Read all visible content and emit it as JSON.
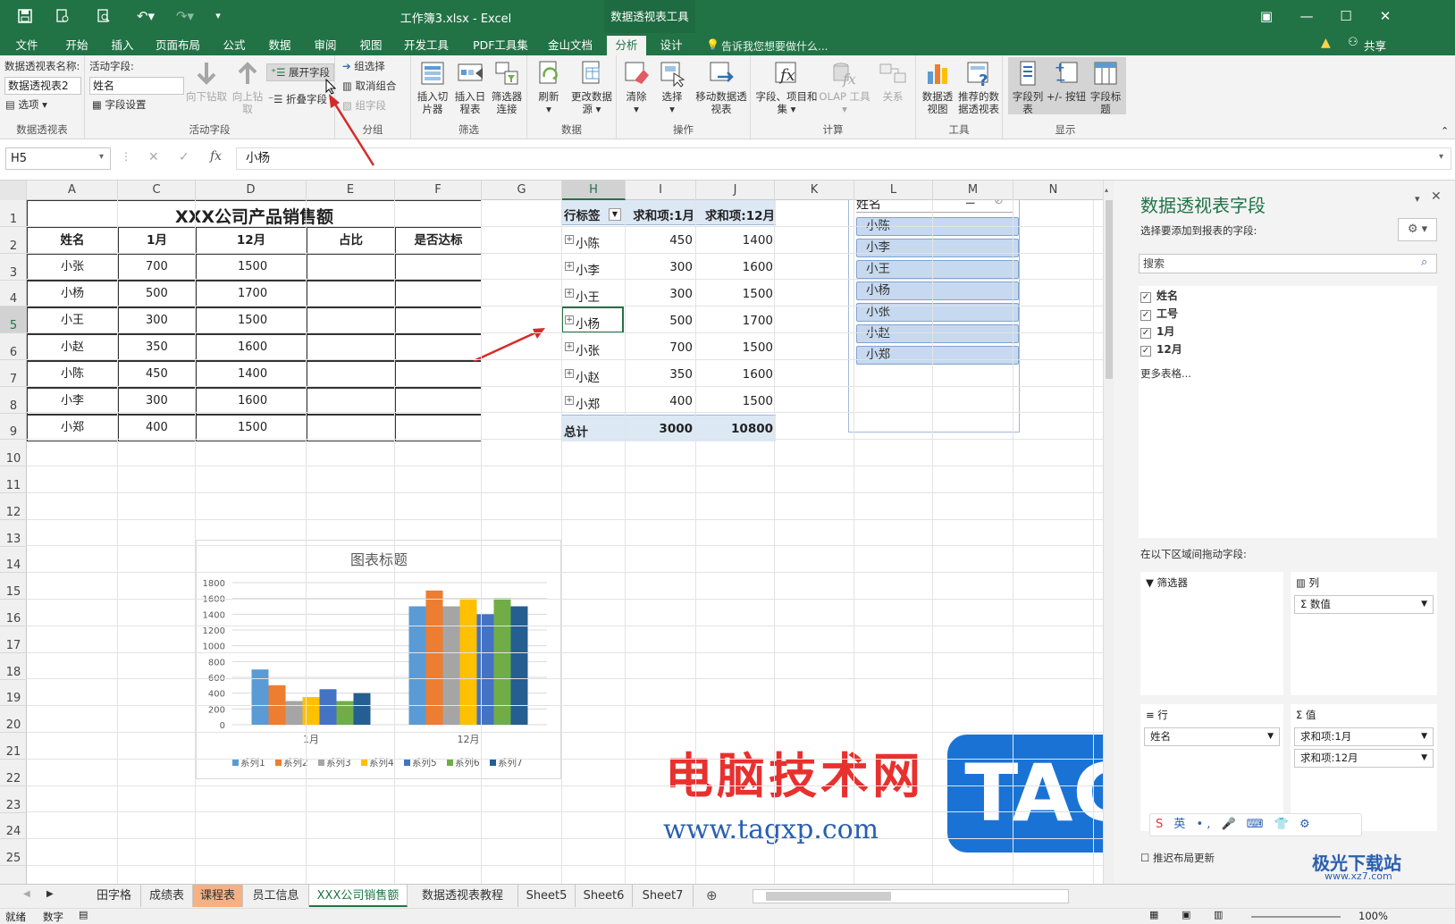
{
  "window": {
    "title": "工作簿3.xlsx - Excel",
    "context_tab": "数据透视表工具"
  },
  "tabs": [
    "文件",
    "开始",
    "插入",
    "页面布局",
    "公式",
    "数据",
    "审阅",
    "视图",
    "开发工具",
    "PDF工具集",
    "金山文档",
    "分析",
    "设计"
  ],
  "tell_me": "告诉我您想要做什么...",
  "share": "共享",
  "ribbon": {
    "pivot_name_label": "数据透视表名称:",
    "pivot_name_value": "数据透视表2",
    "options_label": "选项",
    "group_pivot": "数据透视表",
    "active_field_label": "活动字段:",
    "active_field_value": "姓名",
    "field_settings": "字段设置",
    "drill_down": "向下钻取",
    "drill_up": "向上钻取",
    "expand_field": "展开字段",
    "collapse_field": "折叠字段",
    "group_active": "活动字段",
    "group_selection": "组选择",
    "ungroup": "取消组合",
    "group_field": "组字段",
    "group_group": "分组",
    "insert_slicer": "插入切片器",
    "insert_timeline": "插入日程表",
    "filter_connections": "筛选器连接",
    "group_filter": "筛选",
    "refresh": "刷新",
    "change_source": "更改数据源",
    "group_data": "数据",
    "clear": "清除",
    "select": "选择",
    "move_pivot": "移动数据透视表",
    "group_actions": "操作",
    "fields_items": "字段、项目和集",
    "olap_tools": "OLAP 工具",
    "relationships": "关系",
    "group_calc": "计算",
    "pivot_chart": "数据透视图",
    "recommended": "推荐的数据透视表",
    "group_tools": "工具",
    "field_list": "字段列表",
    "buttons": "+/- 按钮",
    "field_headers": "字段标题",
    "group_show": "显示"
  },
  "formula_bar": {
    "name_box": "H5",
    "fx": "fx",
    "content": "小杨"
  },
  "columns": [
    "A",
    "C",
    "D",
    "E",
    "F",
    "G",
    "H",
    "I",
    "J",
    "K",
    "L",
    "M",
    "N"
  ],
  "rows": [
    "1",
    "2",
    "3",
    "4",
    "5",
    "6",
    "7",
    "8",
    "9",
    "10",
    "11",
    "12",
    "13",
    "14",
    "15",
    "16",
    "17",
    "18",
    "19",
    "20",
    "21",
    "22",
    "23",
    "24",
    "25"
  ],
  "table": {
    "title": "XXX公司产品销售额",
    "headers": [
      "姓名",
      "1月",
      "12月",
      "占比",
      "是否达标"
    ],
    "data": [
      [
        "小张",
        "700",
        "1500"
      ],
      [
        "小杨",
        "500",
        "1700"
      ],
      [
        "小王",
        "300",
        "1500"
      ],
      [
        "小赵",
        "350",
        "1600"
      ],
      [
        "小陈",
        "450",
        "1400"
      ],
      [
        "小李",
        "300",
        "1600"
      ],
      [
        "小郑",
        "400",
        "1500"
      ]
    ]
  },
  "pivot": {
    "headers": [
      "行标签",
      "求和项:1月",
      "求和项:12月"
    ],
    "rows": [
      [
        "小陈",
        "450",
        "1400"
      ],
      [
        "小李",
        "300",
        "1600"
      ],
      [
        "小王",
        "300",
        "1500"
      ],
      [
        "小杨",
        "500",
        "1700"
      ],
      [
        "小张",
        "700",
        "1500"
      ],
      [
        "小赵",
        "350",
        "1600"
      ],
      [
        "小郑",
        "400",
        "1500"
      ]
    ],
    "total": [
      "总计",
      "3000",
      "10800"
    ]
  },
  "slicer": {
    "title": "姓名",
    "items": [
      "小陈",
      "小李",
      "小王",
      "小杨",
      "小张",
      "小赵",
      "小郑"
    ]
  },
  "chart_data": {
    "type": "bar",
    "title": "图表标题",
    "categories": [
      "1月",
      "12月"
    ],
    "ylim": [
      0,
      1800
    ],
    "yticks": [
      0,
      200,
      400,
      600,
      800,
      1000,
      1200,
      1400,
      1600,
      1800
    ],
    "series": [
      {
        "name": "系列1",
        "values": [
          700,
          1500
        ],
        "color": "#5b9bd5"
      },
      {
        "name": "系列2",
        "values": [
          500,
          1700
        ],
        "color": "#ed7d31"
      },
      {
        "name": "系列3",
        "values": [
          300,
          1500
        ],
        "color": "#a5a5a5"
      },
      {
        "name": "系列4",
        "values": [
          350,
          1600
        ],
        "color": "#ffc000"
      },
      {
        "name": "系列5",
        "values": [
          450,
          1400
        ],
        "color": "#4472c4"
      },
      {
        "name": "系列6",
        "values": [
          300,
          1600
        ],
        "color": "#70ad47"
      },
      {
        "name": "系列7",
        "values": [
          400,
          1500
        ],
        "color": "#255e91"
      }
    ],
    "legend": "bottom",
    "grid": true
  },
  "field_pane": {
    "title": "数据透视表字段",
    "subtitle": "选择要添加到报表的字段:",
    "search_placeholder": "搜索",
    "fields": [
      {
        "name": "姓名",
        "checked": true
      },
      {
        "name": "工号",
        "checked": true
      },
      {
        "name": "1月",
        "checked": true
      },
      {
        "name": "12月",
        "checked": true
      }
    ],
    "more_tables": "更多表格...",
    "drag_hint": "在以下区域间拖动字段:",
    "filters": "筛选器",
    "columns": "列",
    "rows": "行",
    "values": "值",
    "col_items": [
      "数值"
    ],
    "row_items": [
      "姓名"
    ],
    "value_items": [
      "求和项:1月",
      "求和项:12月"
    ],
    "defer": "推迟布局更新"
  },
  "sheets": [
    "田字格",
    "成绩表",
    "课程表",
    "员工信息",
    "XXX公司销售额",
    "数据透视表教程",
    "Sheet5",
    "Sheet6",
    "Sheet7"
  ],
  "status": {
    "ready": "就绪",
    "mode": "数字",
    "zoom": "100%"
  },
  "watermark": {
    "text": "电脑技术网",
    "logo": "TAG",
    "url": "www.tagxp.com",
    "site": "极光下载站",
    "site_url": "www.xz7.com"
  }
}
